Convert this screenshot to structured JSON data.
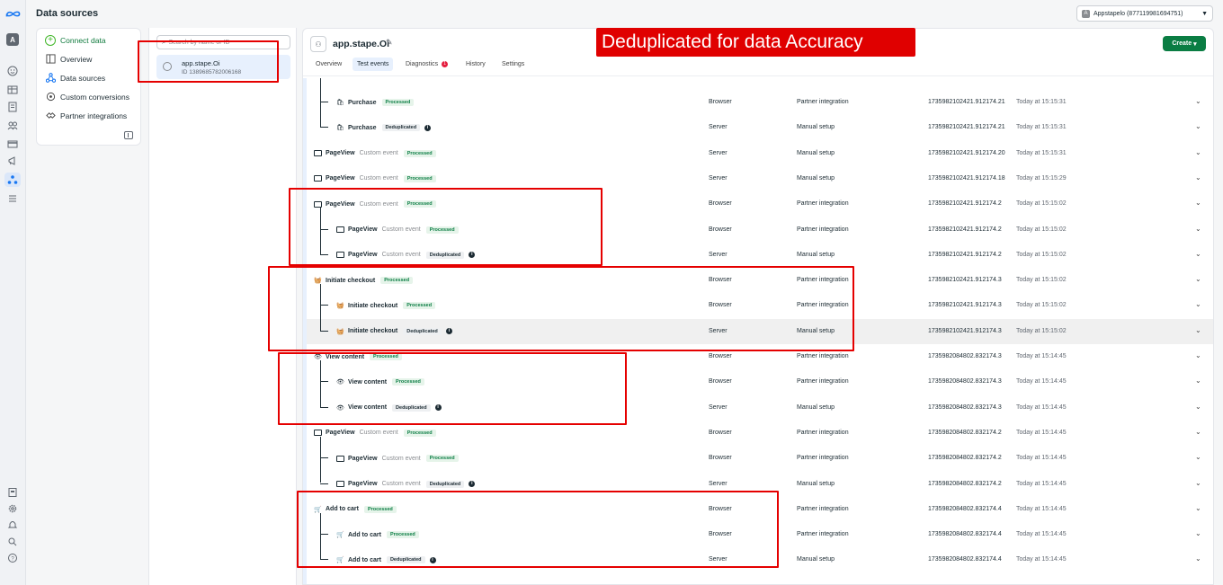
{
  "header": {
    "title": "Data sources",
    "account": "Appstapelo (877119981694751)",
    "account_initial": "A"
  },
  "rail": {
    "avatar": "A",
    "icons": [
      "meta-logo-icon",
      "home-icon",
      "table-icon",
      "pages-icon",
      "audience-icon",
      "billing-icon",
      "megaphone-icon",
      "data-sources-icon",
      "menu-icon",
      "report-icon",
      "settings-icon",
      "bell-icon",
      "search-icon",
      "help-icon"
    ]
  },
  "nav": {
    "items": [
      {
        "label": "Connect data",
        "icon": "plus-circle-icon"
      },
      {
        "label": "Overview",
        "icon": "overview-icon"
      },
      {
        "label": "Data sources",
        "icon": "data-sources-icon"
      },
      {
        "label": "Custom conversions",
        "icon": "custom-conversions-icon"
      },
      {
        "label": "Partner integrations",
        "icon": "partner-integrations-icon"
      }
    ]
  },
  "source_list": {
    "search_placeholder": "Search by name or ID",
    "item": {
      "name": "app.stape.Oi",
      "id": "ID 1389685782006168"
    }
  },
  "main": {
    "title": "app.stape.Oi",
    "create_label": "Create",
    "tabs": [
      {
        "label": "Overview"
      },
      {
        "label": "Test events"
      },
      {
        "label": "Diagnostics",
        "count": "1"
      },
      {
        "label": "History"
      },
      {
        "label": "Settings"
      }
    ],
    "rows": [
      {
        "indent": 1,
        "icon": "bag-icon",
        "name": "Purchase",
        "custom": "",
        "status": "Processed",
        "info": false,
        "source": "Browser",
        "setup": "Partner integration",
        "event_id": "1735982102421.912174.21",
        "time": "Today at 15:15:31"
      },
      {
        "indent": 1,
        "icon": "bag-icon",
        "name": "Purchase",
        "custom": "",
        "status": "Deduplicated",
        "info": true,
        "source": "Server",
        "setup": "Manual setup",
        "event_id": "1735982102421.912174.21",
        "time": "Today at 15:15:31"
      },
      {
        "indent": 0,
        "icon": "page-icon",
        "name": "PageView",
        "custom": "Custom event",
        "status": "Processed",
        "info": false,
        "source": "Server",
        "setup": "Manual setup",
        "event_id": "1735982102421.912174.20",
        "time": "Today at 15:15:31"
      },
      {
        "indent": 0,
        "icon": "page-icon",
        "name": "PageView",
        "custom": "Custom event",
        "status": "Processed",
        "info": false,
        "source": "Server",
        "setup": "Manual setup",
        "event_id": "1735982102421.912174.18",
        "time": "Today at 15:15:29"
      },
      {
        "indent": 0,
        "icon": "page-icon",
        "name": "PageView",
        "custom": "Custom event",
        "status": "Processed",
        "info": false,
        "source": "Browser",
        "setup": "Partner integration",
        "event_id": "1735982102421.912174.2",
        "time": "Today at 15:15:02"
      },
      {
        "indent": 1,
        "icon": "page-icon",
        "name": "PageView",
        "custom": "Custom event",
        "status": "Processed",
        "info": false,
        "source": "Browser",
        "setup": "Partner integration",
        "event_id": "1735982102421.912174.2",
        "time": "Today at 15:15:02"
      },
      {
        "indent": 1,
        "icon": "page-icon",
        "name": "PageView",
        "custom": "Custom event",
        "status": "Deduplicated",
        "info": true,
        "source": "Server",
        "setup": "Manual setup",
        "event_id": "1735982102421.912174.2",
        "time": "Today at 15:15:02"
      },
      {
        "indent": 0,
        "icon": "basket-icon",
        "name": "Initiate checkout",
        "custom": "",
        "status": "Processed",
        "info": false,
        "source": "Browser",
        "setup": "Partner integration",
        "event_id": "1735982102421.912174.3",
        "time": "Today at 15:15:02"
      },
      {
        "indent": 1,
        "icon": "basket-icon",
        "name": "Initiate checkout",
        "custom": "",
        "status": "Processed",
        "info": false,
        "source": "Browser",
        "setup": "Partner integration",
        "event_id": "1735982102421.912174.3",
        "time": "Today at 15:15:02"
      },
      {
        "indent": 1,
        "icon": "basket-icon",
        "name": "Initiate checkout",
        "custom": "",
        "status": "Deduplicated",
        "info": true,
        "source": "Server",
        "setup": "Manual setup",
        "event_id": "1735982102421.912174.3",
        "time": "Today at 15:15:02",
        "highlight": true
      },
      {
        "indent": 0,
        "icon": "eye-icon",
        "name": "View content",
        "custom": "",
        "status": "Processed",
        "info": false,
        "source": "Browser",
        "setup": "Partner integration",
        "event_id": "1735982084802.832174.3",
        "time": "Today at 15:14:45"
      },
      {
        "indent": 1,
        "icon": "eye-icon",
        "name": "View content",
        "custom": "",
        "status": "Processed",
        "info": false,
        "source": "Browser",
        "setup": "Partner integration",
        "event_id": "1735982084802.832174.3",
        "time": "Today at 15:14:45"
      },
      {
        "indent": 1,
        "icon": "eye-icon",
        "name": "View content",
        "custom": "",
        "status": "Deduplicated",
        "info": true,
        "source": "Server",
        "setup": "Manual setup",
        "event_id": "1735982084802.832174.3",
        "time": "Today at 15:14:45"
      },
      {
        "indent": 0,
        "icon": "page-icon",
        "name": "PageView",
        "custom": "Custom event",
        "status": "Processed",
        "info": false,
        "source": "Browser",
        "setup": "Partner integration",
        "event_id": "1735982084802.832174.2",
        "time": "Today at 15:14:45"
      },
      {
        "indent": 1,
        "icon": "page-icon",
        "name": "PageView",
        "custom": "Custom event",
        "status": "Processed",
        "info": false,
        "source": "Browser",
        "setup": "Partner integration",
        "event_id": "1735982084802.832174.2",
        "time": "Today at 15:14:45"
      },
      {
        "indent": 1,
        "icon": "page-icon",
        "name": "PageView",
        "custom": "Custom event",
        "status": "Deduplicated",
        "info": true,
        "source": "Server",
        "setup": "Manual setup",
        "event_id": "1735982084802.832174.2",
        "time": "Today at 15:14:45"
      },
      {
        "indent": 0,
        "icon": "cart-icon",
        "name": "Add to cart",
        "custom": "",
        "status": "Processed",
        "info": false,
        "source": "Browser",
        "setup": "Partner integration",
        "event_id": "1735982084802.832174.4",
        "time": "Today at 15:14:45"
      },
      {
        "indent": 1,
        "icon": "cart-icon",
        "name": "Add to cart",
        "custom": "",
        "status": "Processed",
        "info": false,
        "source": "Browser",
        "setup": "Partner integration",
        "event_id": "1735982084802.832174.4",
        "time": "Today at 15:14:45"
      },
      {
        "indent": 1,
        "icon": "cart-icon",
        "name": "Add to cart",
        "custom": "",
        "status": "Deduplicated",
        "info": true,
        "source": "Server",
        "setup": "Manual setup",
        "event_id": "1735982084802.832174.4",
        "time": "Today at 15:14:45"
      }
    ]
  },
  "annotation": {
    "headline": "Deduplicated for data Accuracy",
    "color": "#e00000"
  },
  "colors": {
    "processed": "#0a7d43",
    "create": "#0a7d43",
    "accent": "#1877f2"
  }
}
